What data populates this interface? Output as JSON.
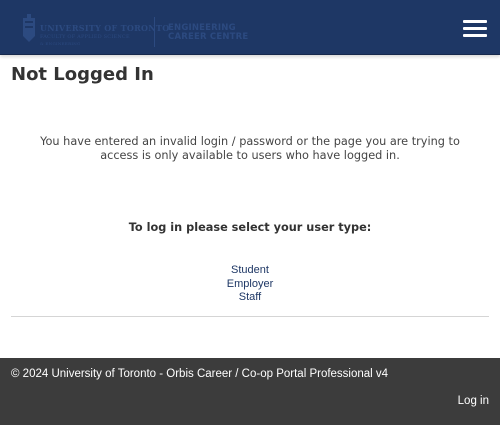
{
  "header": {
    "logo_uoft_line1": "UNIVERSITY OF TORONTO",
    "logo_uoft_line2": "FACULTY OF APPLIED SCIENCE",
    "logo_uoft_line3": "& ENGINEERING",
    "logo_ecc_line1": "ENGINEERING",
    "logo_ecc_line2": "CAREER CENTRE",
    "menu_icon": "hamburger-menu-icon"
  },
  "main": {
    "title": "Not Logged In",
    "message": "You have entered an invalid login / password or the page you are trying to access is only available to users who have logged in.",
    "prompt": "To log in please select your user type:",
    "user_types": [
      "Student",
      "Employer",
      "Staff"
    ]
  },
  "footer": {
    "copyright": "© 2024 University of Toronto - Orbis Career / Co-op Portal Professional v4",
    "login_label": "Log in"
  },
  "colors": {
    "header_bg": "#1e3765",
    "footer_bg": "#3c3c3c",
    "link": "#1e3765"
  }
}
